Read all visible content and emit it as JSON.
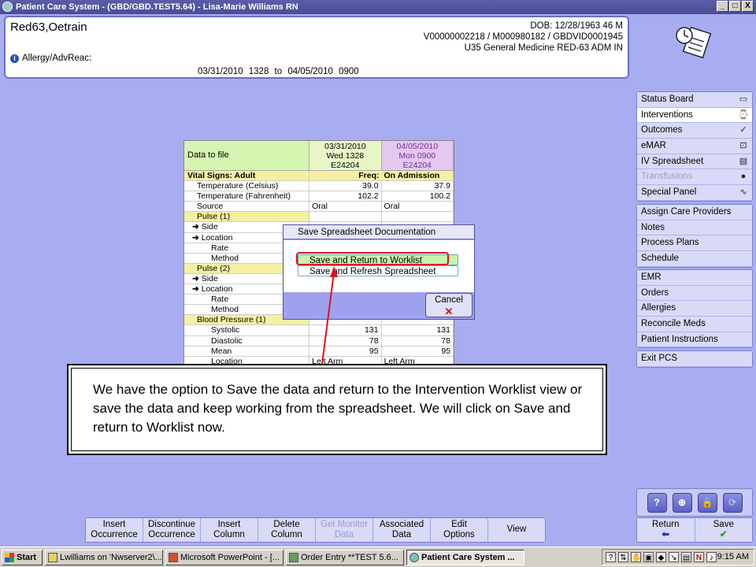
{
  "window": {
    "title": "Patient Care System - (GBD/GBD.TEST5.64) - Lisa-Marie Williams RN",
    "buttons": [
      "_",
      "□",
      "X"
    ]
  },
  "patient": {
    "name": "Red63,Oetrain",
    "dob": "DOB: 12/28/1963 46 M",
    "ids": "V00000002218 / M000980182 / GBDVID0001945",
    "location": "U35 General Medicine RED-63 ADM IN",
    "allergy_label": "Allergy/AdvReac:",
    "date_range": "03/31/2010 1328  to  04/05/2010 0900"
  },
  "nav": {
    "group1": [
      {
        "label": "Status Board",
        "icon": "book-icon",
        "glyph": "▭"
      },
      {
        "label": "Interventions",
        "icon": "intervention-icon",
        "glyph": "⌚",
        "active": true
      },
      {
        "label": "Outcomes",
        "icon": "checkmark-icon",
        "glyph": "✓"
      },
      {
        "label": "eMAR",
        "icon": "emar-icon",
        "glyph": "⊡"
      },
      {
        "label": "IV Spreadsheet",
        "icon": "iv-icon",
        "glyph": "▤"
      },
      {
        "label": "Transfusions",
        "icon": "drop-icon",
        "glyph": "●",
        "disabled": true
      },
      {
        "label": "Special Panel",
        "icon": "pulse-icon",
        "glyph": "∿"
      }
    ],
    "group2": [
      "Assign Care Providers",
      "Notes",
      "Process Plans",
      "Schedule"
    ],
    "group3": [
      "EMR",
      "Orders",
      "Allergies",
      "Reconcile Meds",
      "Patient Instructions"
    ],
    "group4": [
      "Exit PCS"
    ]
  },
  "datapanel": {
    "label": "Data to file",
    "col1": [
      "03/31/2010",
      "Wed  1328",
      "E24204"
    ],
    "col2": [
      "04/05/2010",
      "Mon  0900",
      "E24204"
    ],
    "rows": [
      {
        "label": "Vital Signs: Adult",
        "v1": "Freq:",
        "v2": "On Admission",
        "type": "header"
      },
      {
        "label": "Temperature (Celsius)",
        "v1": "39.0",
        "v2": "37.9",
        "indent": 1,
        "num": true
      },
      {
        "label": "Temperature (Fahrenheit)",
        "v1": "102.2",
        "v2": "100.2",
        "indent": 1,
        "num": true
      },
      {
        "label": "Source",
        "v1": "Oral",
        "v2": "Oral",
        "indent": 1
      },
      {
        "label": "Pulse (1)",
        "v1": "",
        "v2": "",
        "indent": 1,
        "type": "group"
      },
      {
        "label": "Side",
        "v1": "",
        "v2": "",
        "indent": 2,
        "arrow": true
      },
      {
        "label": "Location",
        "v1": "",
        "v2": "",
        "indent": 2,
        "arrow": true
      },
      {
        "label": "Rate",
        "v1": "",
        "v2": "",
        "indent": 3
      },
      {
        "label": "Method",
        "v1": "",
        "v2": "",
        "indent": 3
      },
      {
        "label": "Pulse (2)",
        "v1": "",
        "v2": "",
        "indent": 1,
        "type": "group"
      },
      {
        "label": "Side",
        "v1": "",
        "v2": "",
        "indent": 2,
        "arrow": true
      },
      {
        "label": "Location",
        "v1": "",
        "v2": "",
        "indent": 2,
        "arrow": true
      },
      {
        "label": "Rate",
        "v1": "",
        "v2": "",
        "indent": 3
      },
      {
        "label": "Method",
        "v1": "",
        "v2": "",
        "indent": 3
      },
      {
        "label": "Blood Pressure (1)",
        "v1": "",
        "v2": "",
        "indent": 1,
        "type": "group"
      },
      {
        "label": "Systolic",
        "v1": "131",
        "v2": "131",
        "indent": 3,
        "num": true
      },
      {
        "label": "Diastolic",
        "v1": "78",
        "v2": "78",
        "indent": 3,
        "num": true
      },
      {
        "label": "Mean",
        "v1": "95",
        "v2": "95",
        "indent": 3,
        "num": true
      },
      {
        "label": "Location",
        "v1": "Left Arm",
        "v2": "Left Arm",
        "indent": 3
      }
    ]
  },
  "dialog": {
    "title": "Save Spreadsheet Documentation",
    "option1": "Save and Return to Worklist",
    "option2": "Save and Refresh Spreadsheet",
    "cancel": "Cancel"
  },
  "callout": {
    "text": "We have the option to Save the data and return to the Intervention Worklist view or save the data and keep working from the spreadsheet. We will click on Save and return to Worklist now."
  },
  "help_buttons": [
    "?",
    "⊕",
    "🔒",
    "⟳"
  ],
  "toolbar": [
    {
      "line1": "Insert",
      "line2": "Occurrence"
    },
    {
      "line1": "Discontinue",
      "line2": "Occurrence"
    },
    {
      "line1": "Insert",
      "line2": "Column"
    },
    {
      "line1": "Delete",
      "line2": "Column"
    },
    {
      "line1": "Get Monitor",
      "line2": "Data",
      "disabled": true
    },
    {
      "line1": "Associated",
      "line2": "Data"
    },
    {
      "line1": "Edit",
      "line2": "Options"
    },
    {
      "line1": "View",
      "line2": ""
    }
  ],
  "return_save": {
    "return": "Return",
    "save": "Save"
  },
  "taskbar": {
    "start": "Start",
    "tasks": [
      "Lwilliams on 'Nwserver2\\...",
      "Microsoft PowerPoint - [...",
      "Order Entry **TEST 5.6...",
      "Patient Care System ..."
    ],
    "clock": "9:15 AM"
  }
}
